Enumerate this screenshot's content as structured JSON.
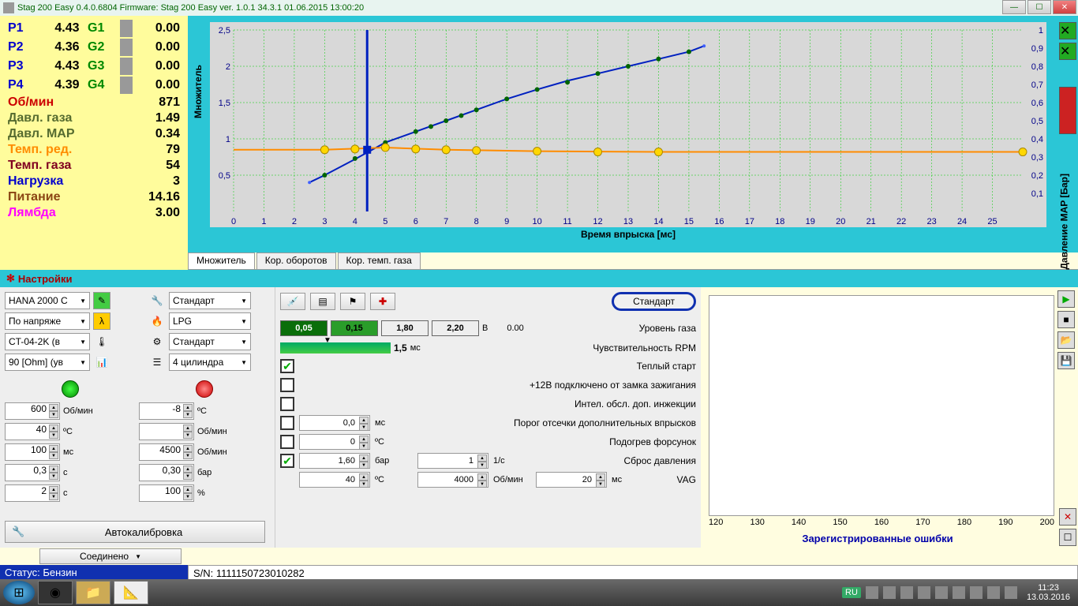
{
  "titlebar": {
    "text": "Stag 200 Easy 0.4.0.6804 Firmware: Stag 200 Easy  ver. 1.0.1  34.3.1   01.06.2015 13:00:20"
  },
  "params": {
    "p": [
      {
        "label": "P1",
        "val": "4.43",
        "g": "G1",
        "gval": "0.00"
      },
      {
        "label": "P2",
        "val": "4.36",
        "g": "G2",
        "gval": "0.00"
      },
      {
        "label": "P3",
        "val": "4.43",
        "g": "G3",
        "gval": "0.00"
      },
      {
        "label": "P4",
        "val": "4.39",
        "g": "G4",
        "gval": "0.00"
      }
    ],
    "rows": [
      {
        "label": "Об/мин",
        "val": "871",
        "cls": "c-red"
      },
      {
        "label": "Давл. газа",
        "val": "1.49",
        "cls": "c-dgreen"
      },
      {
        "label": "Давл. MAP",
        "val": "0.34",
        "cls": "c-dgreen"
      },
      {
        "label": "Темп. ред.",
        "val": "79",
        "cls": "c-orange"
      },
      {
        "label": "Темп. газа",
        "val": "54",
        "cls": "c-darkred"
      },
      {
        "label": "Нагрузка",
        "val": "3",
        "cls": "c-blue"
      },
      {
        "label": "Питание",
        "val": "14.16",
        "cls": "c-brown"
      },
      {
        "label": "Лямбда",
        "val": "3.00",
        "cls": "c-magenta"
      }
    ]
  },
  "chart_data": {
    "type": "scatter-line",
    "xlabel": "Время впрыска [мс]",
    "ylabel": "Множитель",
    "y2label": "Давление MAP [Бар]",
    "xlim": [
      0,
      26
    ],
    "ylim": [
      0,
      2.5
    ],
    "y2lim": [
      0,
      1
    ],
    "xticks": [
      0,
      1,
      2,
      3,
      4,
      5,
      6,
      7,
      8,
      9,
      10,
      11,
      12,
      13,
      14,
      15,
      16,
      17,
      18,
      19,
      20,
      21,
      22,
      23,
      24,
      25
    ],
    "yticks": [
      0.5,
      1,
      1.5,
      2,
      2.5
    ],
    "y2ticks": [
      0.1,
      0.2,
      0.3,
      0.4,
      0.5,
      0.6,
      0.7,
      0.8,
      0.9,
      1
    ],
    "cursor_x": 4.4,
    "series": [
      {
        "name": "multiplier-line",
        "color": "#0020c0",
        "points": [
          [
            2.5,
            0.4
          ],
          [
            3,
            0.5
          ],
          [
            4,
            0.72
          ],
          [
            5,
            0.95
          ],
          [
            6,
            1.1
          ],
          [
            7,
            1.25
          ],
          [
            8,
            1.4
          ],
          [
            9,
            1.55
          ],
          [
            10,
            1.68
          ],
          [
            11,
            1.8
          ],
          [
            12,
            1.9
          ],
          [
            13,
            2.0
          ],
          [
            14,
            2.1
          ],
          [
            15,
            2.2
          ],
          [
            15.5,
            2.28
          ]
        ]
      },
      {
        "name": "green-dots",
        "color": "#006400",
        "points": [
          [
            3,
            0.5
          ],
          [
            4,
            0.73
          ],
          [
            5,
            0.95
          ],
          [
            6,
            1.1
          ],
          [
            6.5,
            1.17
          ],
          [
            7,
            1.25
          ],
          [
            7.5,
            1.32
          ],
          [
            8,
            1.4
          ],
          [
            9,
            1.55
          ],
          [
            10,
            1.68
          ],
          [
            11,
            1.78
          ],
          [
            12,
            1.9
          ],
          [
            13,
            2.0
          ],
          [
            14,
            2.1
          ],
          [
            15,
            2.2
          ]
        ]
      },
      {
        "name": "map-line",
        "color": "#ff8c00",
        "points": [
          [
            0,
            0.85
          ],
          [
            3,
            0.85
          ],
          [
            5,
            0.88
          ],
          [
            7,
            0.85
          ],
          [
            10,
            0.83
          ],
          [
            14,
            0.82
          ],
          [
            26,
            0.82
          ]
        ]
      },
      {
        "name": "yellow-markers",
        "color": "#ffd700",
        "points": [
          [
            3,
            0.85
          ],
          [
            4,
            0.86
          ],
          [
            5,
            0.88
          ],
          [
            6,
            0.86
          ],
          [
            7,
            0.85
          ],
          [
            8,
            0.84
          ],
          [
            10,
            0.83
          ],
          [
            12,
            0.82
          ],
          [
            14,
            0.82
          ],
          [
            26,
            0.82
          ]
        ]
      }
    ]
  },
  "tabs": {
    "items": [
      "Множитель",
      "Кор. оборотов",
      "Кор. темп. газа"
    ],
    "active": 0
  },
  "settings": {
    "title": "Настройки",
    "left": {
      "dd1": "HANA 2000 С",
      "dd2": "По напряже",
      "dd3": "CT-04-2K (в",
      "dd4": "90 [Ohm] (ув",
      "ddr1": "Стандарт",
      "ddr2": "LPG",
      "ddr3": "Стандарт",
      "ddr4": "4 цилиндра",
      "col1": [
        {
          "val": "600",
          "unit": "Об/мин"
        },
        {
          "val": "40",
          "unit": "ºC"
        },
        {
          "val": "100",
          "unit": "мс"
        },
        {
          "val": "0,3",
          "unit": "с"
        },
        {
          "val": "2",
          "unit": "с"
        }
      ],
      "col2": [
        {
          "val": "-8",
          "unit": "ºC"
        },
        {
          "val": "",
          "unit": "Об/мин"
        },
        {
          "val": "4500",
          "unit": "Об/мин"
        },
        {
          "val": "0,30",
          "unit": "бар"
        },
        {
          "val": "100",
          "unit": "%"
        }
      ],
      "autocal": "Автокалибровка"
    },
    "mid": {
      "std_btn": "Стандарт",
      "level": {
        "v1": "0,05",
        "v2": "0,15",
        "v3": "1,80",
        "v4": "2,20",
        "b": "В",
        "z": "0.00",
        "label": "Уровень газа"
      },
      "sens": {
        "val": "1,5",
        "unit": "мс",
        "label": "Чувствительность RPM"
      },
      "opts": [
        {
          "chk": true,
          "label": "Теплый старт"
        },
        {
          "chk": false,
          "label": "+12В подключено от замка зажигания"
        },
        {
          "chk": false,
          "label": "Интел. обсл. доп. инжекции"
        },
        {
          "chk": false,
          "field": "0,0",
          "unit": "мс",
          "label": "Порог отсечки дополнительных впрысков"
        },
        {
          "chk": false,
          "field": "0",
          "unit": "ºC",
          "label": "Подогрев форсунок"
        },
        {
          "chk": true,
          "field": "1,60",
          "unit": "бар",
          "field2": "1",
          "unit2": "1/с",
          "label": "Сброс давления"
        },
        {
          "nochk": true,
          "field": "40",
          "unit": "ºC",
          "field2": "4000",
          "unit2": "Об/мин",
          "field3": "20",
          "unit3": "мс",
          "label": "VAG"
        }
      ]
    },
    "right": {
      "axis": [
        "120",
        "130",
        "140",
        "150",
        "160",
        "170",
        "180",
        "190",
        "200"
      ],
      "errors": "Зарегистрированные ошибки"
    }
  },
  "conn": "Соединено",
  "status": {
    "left": "Статус: Бензин",
    "right": "S/N: 1111150723010282"
  },
  "taskbar": {
    "lang": "RU",
    "time": "11:23",
    "date": "13.03.2016"
  }
}
